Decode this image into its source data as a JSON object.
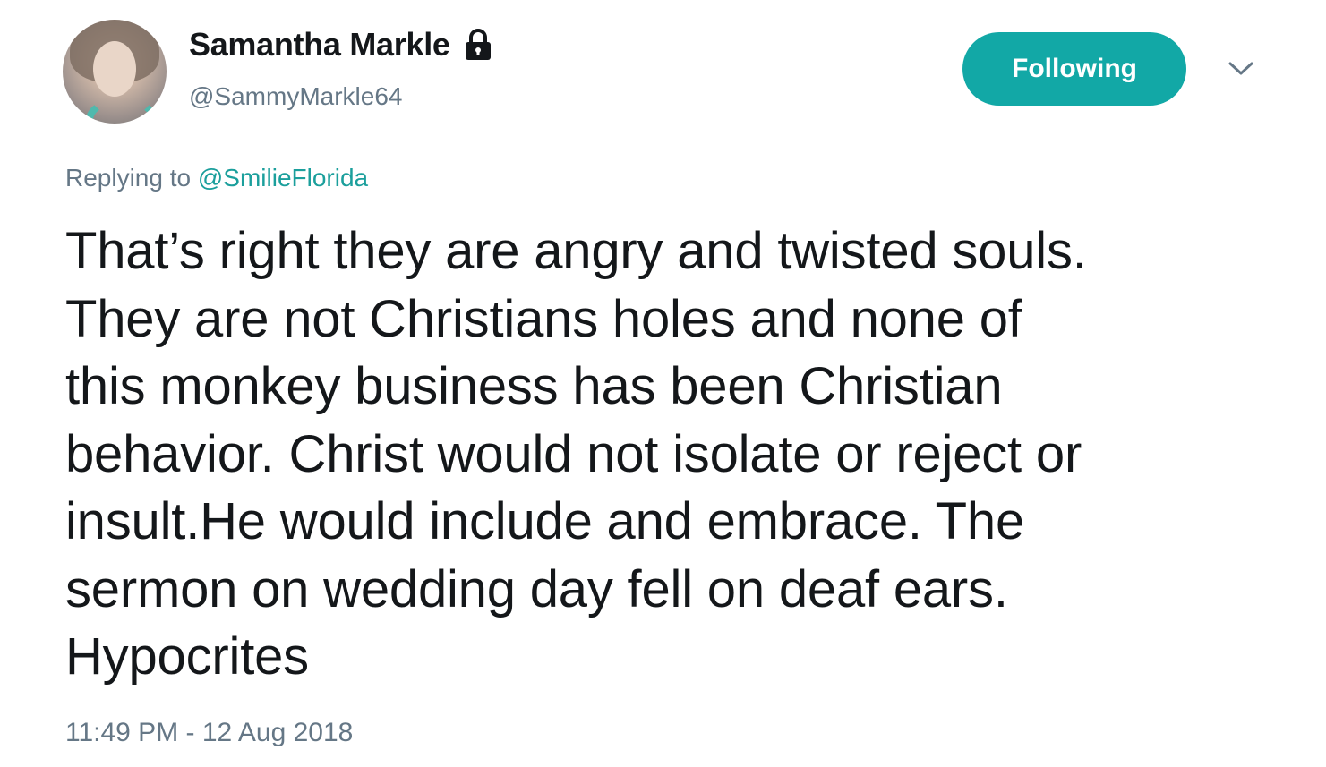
{
  "author": {
    "display_name": "Samantha Markle",
    "handle": "@SammyMarkle64",
    "protected": true
  },
  "actions": {
    "follow_label": "Following"
  },
  "reply": {
    "prefix": "Replying to ",
    "mention": "@SmilieFlorida"
  },
  "tweet": {
    "lines": [
      "That’s right they are angry and twisted souls.",
      "They are not Christians holes and none of",
      "this monkey business has been Christian",
      "behavior. Christ would not isolate or reject or",
      "insult.He would include and embrace. The",
      "sermon on wedding day fell on deaf ears.",
      "Hypocrites"
    ],
    "timestamp": "11:49 PM - 12 Aug 2018"
  },
  "icons": {
    "lock": "lock-icon",
    "caret": "chevron-down-icon"
  },
  "colors": {
    "accent": "#12a8a6",
    "mention": "#1b9f9c",
    "secondary_text": "#657786",
    "primary_text": "#14171a"
  }
}
